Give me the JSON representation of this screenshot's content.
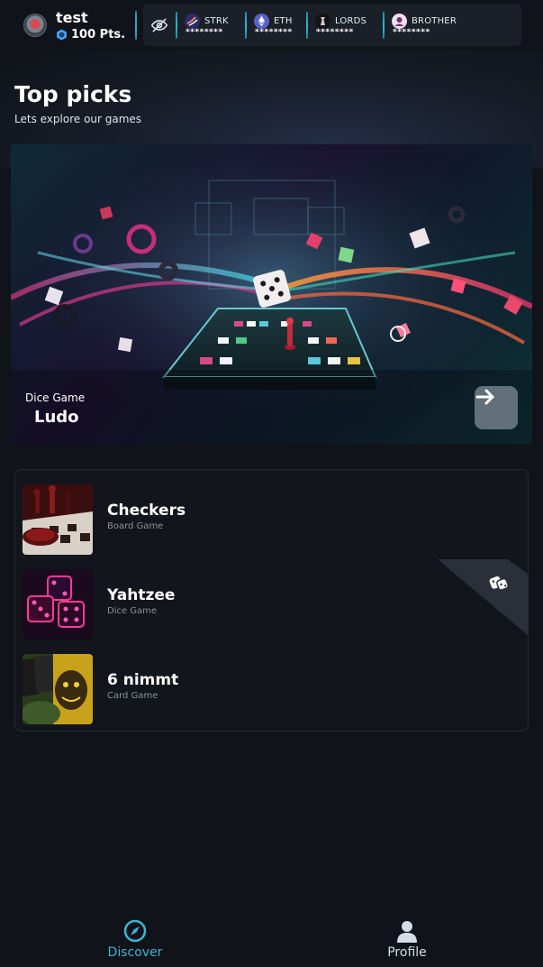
{
  "user": {
    "name": "test",
    "points": "100 Pts."
  },
  "balances": [
    {
      "symbol": "STRK",
      "amount": "********",
      "icon": "starknet-icon",
      "color": "#2b2d6b"
    },
    {
      "symbol": "ETH",
      "amount": "********",
      "icon": "ethereum-icon",
      "color": "#5a62c8"
    },
    {
      "symbol": "LORDS",
      "amount": "********",
      "icon": "lords-icon",
      "color": "#121212"
    },
    {
      "symbol": "BROTHER",
      "amount": "********",
      "icon": "brother-icon",
      "color": "#e8d6e8"
    }
  ],
  "top_picks": {
    "title": "Top picks",
    "subtitle": "Lets explore our games",
    "featured": {
      "category": "Dice Game",
      "name": "Ludo"
    }
  },
  "games": [
    {
      "name": "Checkers",
      "type": "Board Game",
      "thumb": "checkers"
    },
    {
      "name": "Yahtzee",
      "type": "Dice Game",
      "thumb": "yahtzee",
      "badge": "dice-icon"
    },
    {
      "name": "6 nimmt",
      "type": "Card Game",
      "thumb": "cards"
    }
  ],
  "nav": {
    "discover": "Discover",
    "profile": "Profile"
  },
  "colors": {
    "accent": "#3eb5d3",
    "background": "#101319",
    "panel": "#1b1f27"
  }
}
